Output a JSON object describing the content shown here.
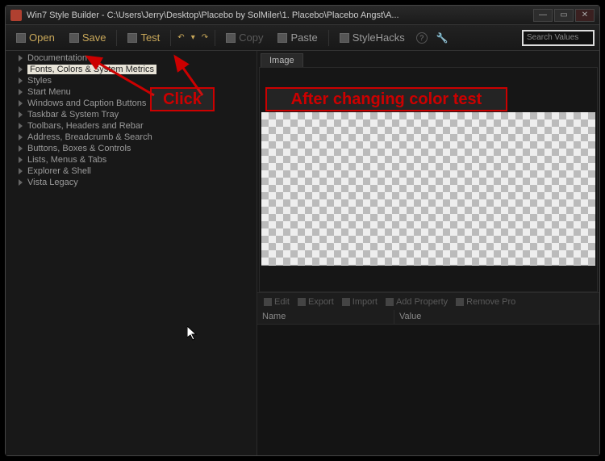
{
  "title": "Win7 Style Builder - C:\\Users\\Jerry\\Desktop\\Placebo by SolMiler\\1. Placebo\\Placebo Angst\\A...",
  "toolbar": {
    "open": "Open",
    "save": "Save",
    "test": "Test",
    "copy": "Copy",
    "paste": "Paste",
    "stylehacks": "StyleHacks",
    "search_placeholder": "Search Values"
  },
  "sidebar": {
    "items": [
      {
        "label": "Documentation"
      },
      {
        "label": "Fonts, Colors & System Metrics"
      },
      {
        "label": "Styles"
      },
      {
        "label": "Start Menu"
      },
      {
        "label": "Windows and Caption Buttons"
      },
      {
        "label": "Taskbar & System Tray"
      },
      {
        "label": "Toolbars, Headers and Rebar"
      },
      {
        "label": "Address, Breadcrumb & Search"
      },
      {
        "label": "Buttons, Boxes & Controls"
      },
      {
        "label": "Lists, Menus & Tabs"
      },
      {
        "label": "Explorer & Shell"
      },
      {
        "label": "Vista Legacy"
      }
    ],
    "selected_index": 1
  },
  "right": {
    "tab": "Image",
    "propbar": {
      "edit": "Edit",
      "export": "Export",
      "import": "Import",
      "add": "Add Property",
      "remove": "Remove Pro"
    },
    "grid": {
      "col_name": "Name",
      "col_value": "Value"
    }
  },
  "annotations": {
    "click": "Click",
    "after": "After changing color test"
  }
}
